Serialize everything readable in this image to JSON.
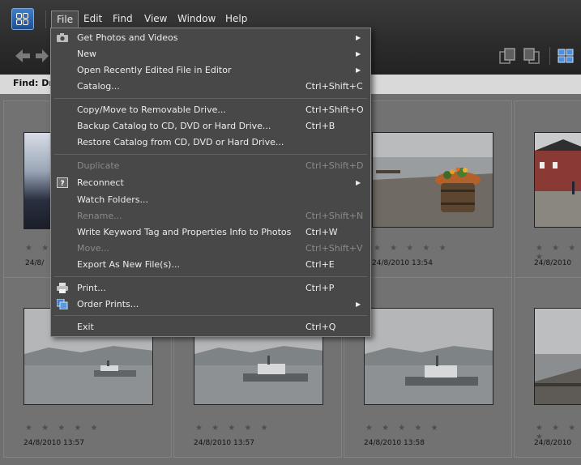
{
  "menubar": {
    "items": [
      "File",
      "Edit",
      "Find",
      "View",
      "Window",
      "Help"
    ]
  },
  "findbar": {
    "label": "Find: Dra"
  },
  "file_menu": {
    "items": [
      {
        "label": "Get Photos and Videos",
        "shortcut": "",
        "submenu": true,
        "disabled": false,
        "icon": "camera-icon"
      },
      {
        "label": "New",
        "shortcut": "",
        "submenu": true,
        "disabled": false,
        "icon": ""
      },
      {
        "label": "Open Recently Edited File in Editor",
        "shortcut": "",
        "submenu": true,
        "disabled": false,
        "icon": ""
      },
      {
        "label": "Catalog...",
        "shortcut": "Ctrl+Shift+C",
        "submenu": false,
        "disabled": false,
        "icon": ""
      },
      {
        "label": "Copy/Move to Removable Drive...",
        "shortcut": "Ctrl+Shift+O",
        "submenu": false,
        "disabled": false,
        "icon": ""
      },
      {
        "label": "Backup Catalog to CD, DVD or Hard Drive...",
        "shortcut": "Ctrl+B",
        "submenu": false,
        "disabled": false,
        "icon": ""
      },
      {
        "label": "Restore Catalog from CD, DVD or Hard Drive...",
        "shortcut": "",
        "submenu": false,
        "disabled": false,
        "icon": ""
      },
      {
        "label": "Duplicate",
        "shortcut": "Ctrl+Shift+D",
        "submenu": false,
        "disabled": true,
        "icon": ""
      },
      {
        "label": "Reconnect",
        "shortcut": "",
        "submenu": true,
        "disabled": false,
        "icon": "question-icon"
      },
      {
        "label": "Watch Folders...",
        "shortcut": "",
        "submenu": false,
        "disabled": false,
        "icon": ""
      },
      {
        "label": "Rename...",
        "shortcut": "Ctrl+Shift+N",
        "submenu": false,
        "disabled": true,
        "icon": ""
      },
      {
        "label": "Write Keyword Tag and Properties Info to Photos",
        "shortcut": "Ctrl+W",
        "submenu": false,
        "disabled": false,
        "icon": ""
      },
      {
        "label": "Move...",
        "shortcut": "Ctrl+Shift+V",
        "submenu": false,
        "disabled": true,
        "icon": ""
      },
      {
        "label": "Export As New File(s)...",
        "shortcut": "Ctrl+E",
        "submenu": false,
        "disabled": false,
        "icon": ""
      },
      {
        "label": "Print...",
        "shortcut": "Ctrl+P",
        "submenu": false,
        "disabled": false,
        "icon": "printer-icon"
      },
      {
        "label": "Order Prints...",
        "shortcut": "",
        "submenu": true,
        "disabled": false,
        "icon": "order-prints-icon"
      },
      {
        "label": "Exit",
        "shortcut": "Ctrl+Q",
        "submenu": false,
        "disabled": false,
        "icon": ""
      }
    ]
  },
  "photos": {
    "row1": [
      {
        "date": "",
        "stars": "★ ★"
      },
      {
        "date": "",
        "stars": ""
      },
      {
        "date": "24/8/2010 13:54",
        "stars": "★ ★ ★ ★ ★"
      },
      {
        "date": "24/8/2010",
        "stars": "★ ★ ★ ★"
      }
    ],
    "row1_left_date": "24/8/",
    "row2": [
      {
        "date": "24/8/2010 13:57",
        "stars": "★ ★ ★ ★ ★"
      },
      {
        "date": "24/8/2010 13:57",
        "stars": "★ ★ ★ ★ ★"
      },
      {
        "date": "24/8/2010 13:58",
        "stars": "★ ★ ★ ★ ★"
      },
      {
        "date": "24/8/2010",
        "stars": "★ ★ ★ ★"
      }
    ]
  },
  "colors": {
    "menu_bg": "#484848",
    "accent": "#3f7fc8"
  }
}
